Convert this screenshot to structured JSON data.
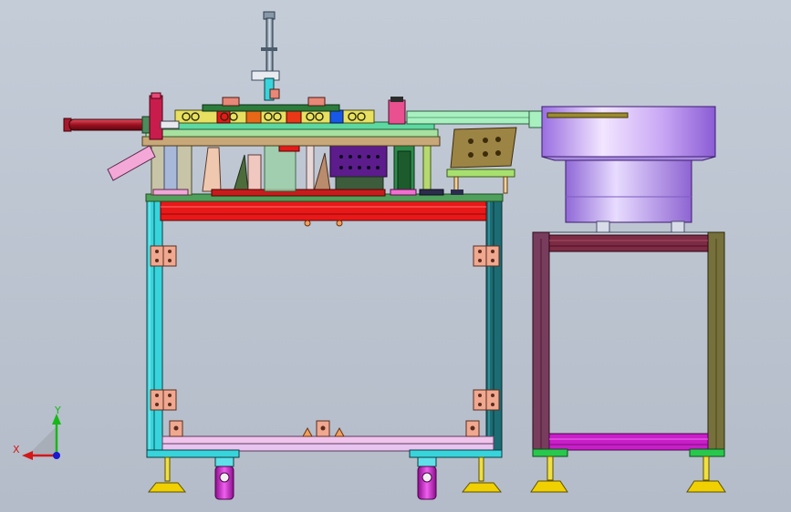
{
  "view": {
    "background_top": "#c4ccd8",
    "background_bottom": "#b4bcc9",
    "triad": {
      "x_label": "X",
      "y_label": "Y",
      "x_color": "#d41818",
      "y_color": "#18b818",
      "z_color": "#1a1ad0"
    }
  },
  "colors": {
    "frame_cyan": "#38d4dc",
    "frame_teal": "#1c6c74",
    "frame_plum": "#783c5c",
    "frame_olive": "#76703c",
    "red_plate": "#e81818",
    "violet": "#c89cf0",
    "magenta": "#c81ec8",
    "hinge": "#f0a890",
    "foot": "#f0d000",
    "rod": "#b81c2c"
  }
}
